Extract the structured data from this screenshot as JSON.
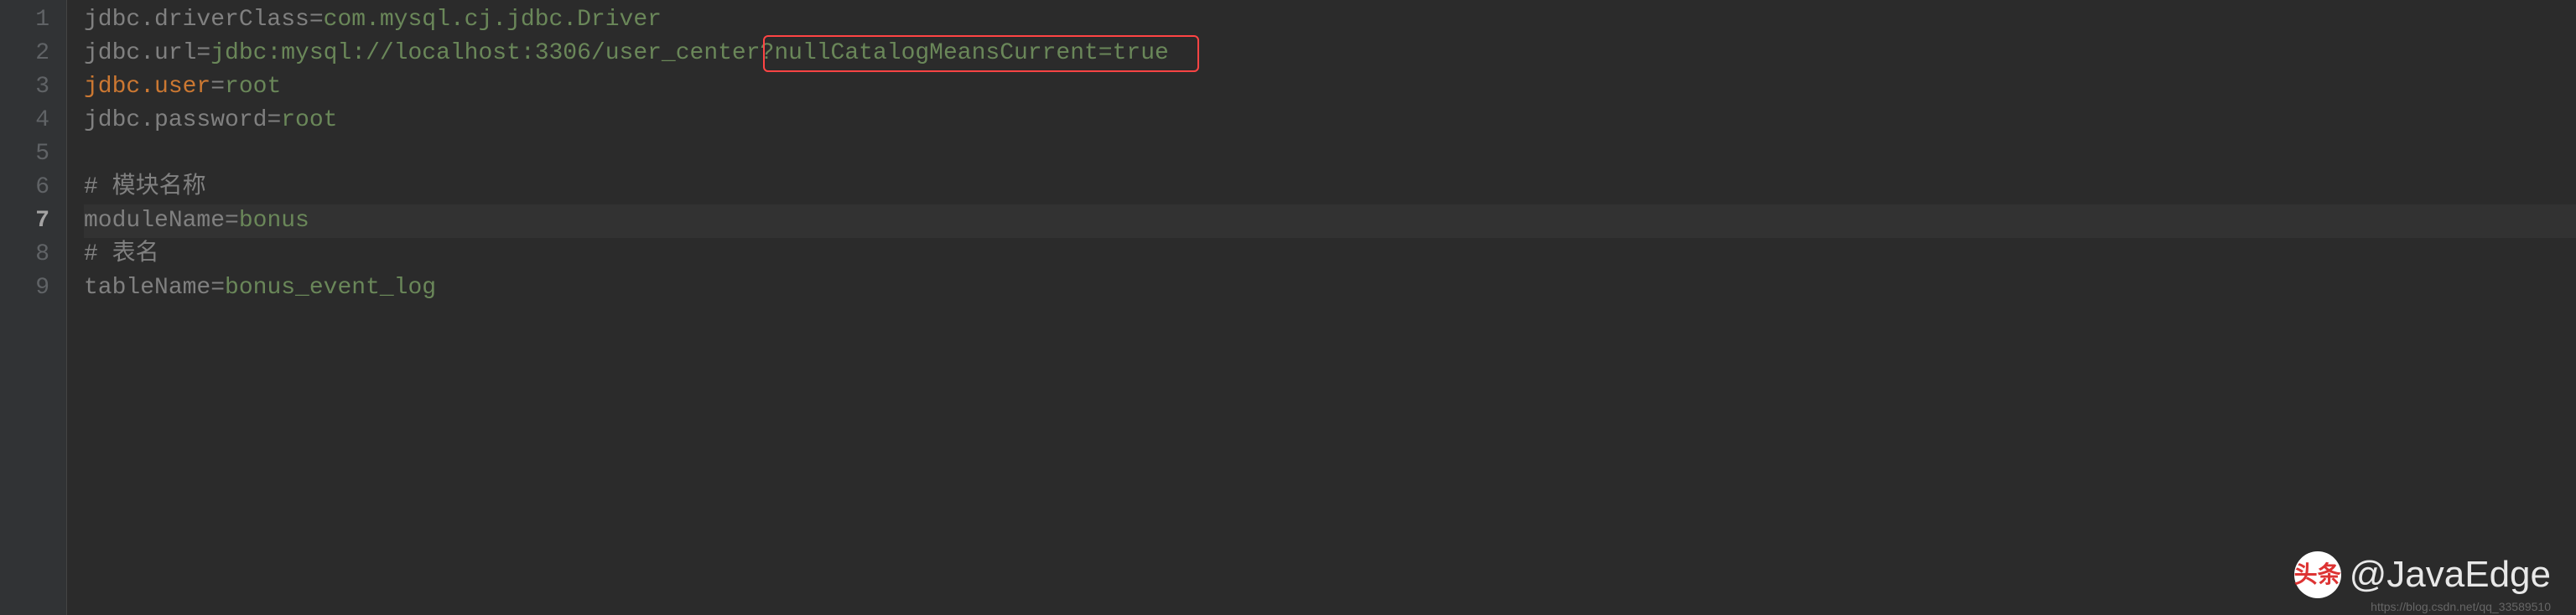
{
  "gutter": [
    "1",
    "2",
    "3",
    "4",
    "5",
    "6",
    "7",
    "8",
    "9"
  ],
  "currentLine": 7,
  "lines": {
    "1": {
      "key": "jdbc.driverClass",
      "value": "com.mysql.cj.jdbc.Driver"
    },
    "2": {
      "key": "jdbc.url",
      "value": "jdbc:mysql://localhost:3306/user_center?nullCatalogMeansCurrent=true"
    },
    "3": {
      "key": "jdbc.user",
      "value": "root",
      "keyHighlight": true
    },
    "4": {
      "key": "jdbc.password",
      "value": "root"
    },
    "5": {
      "empty": true
    },
    "6": {
      "comment": "# 模块名称"
    },
    "7": {
      "key": "moduleName",
      "value": "bonus"
    },
    "8": {
      "comment": "# 表名"
    },
    "9": {
      "key": "tableName",
      "value": "bonus_event_log"
    }
  },
  "highlight": {
    "text": "nullCatalogMeansCurrent=true"
  },
  "watermark": {
    "logo": "头条",
    "text": "@JavaEdge",
    "sub": "https://blog.csdn.net/qq_33589510"
  }
}
